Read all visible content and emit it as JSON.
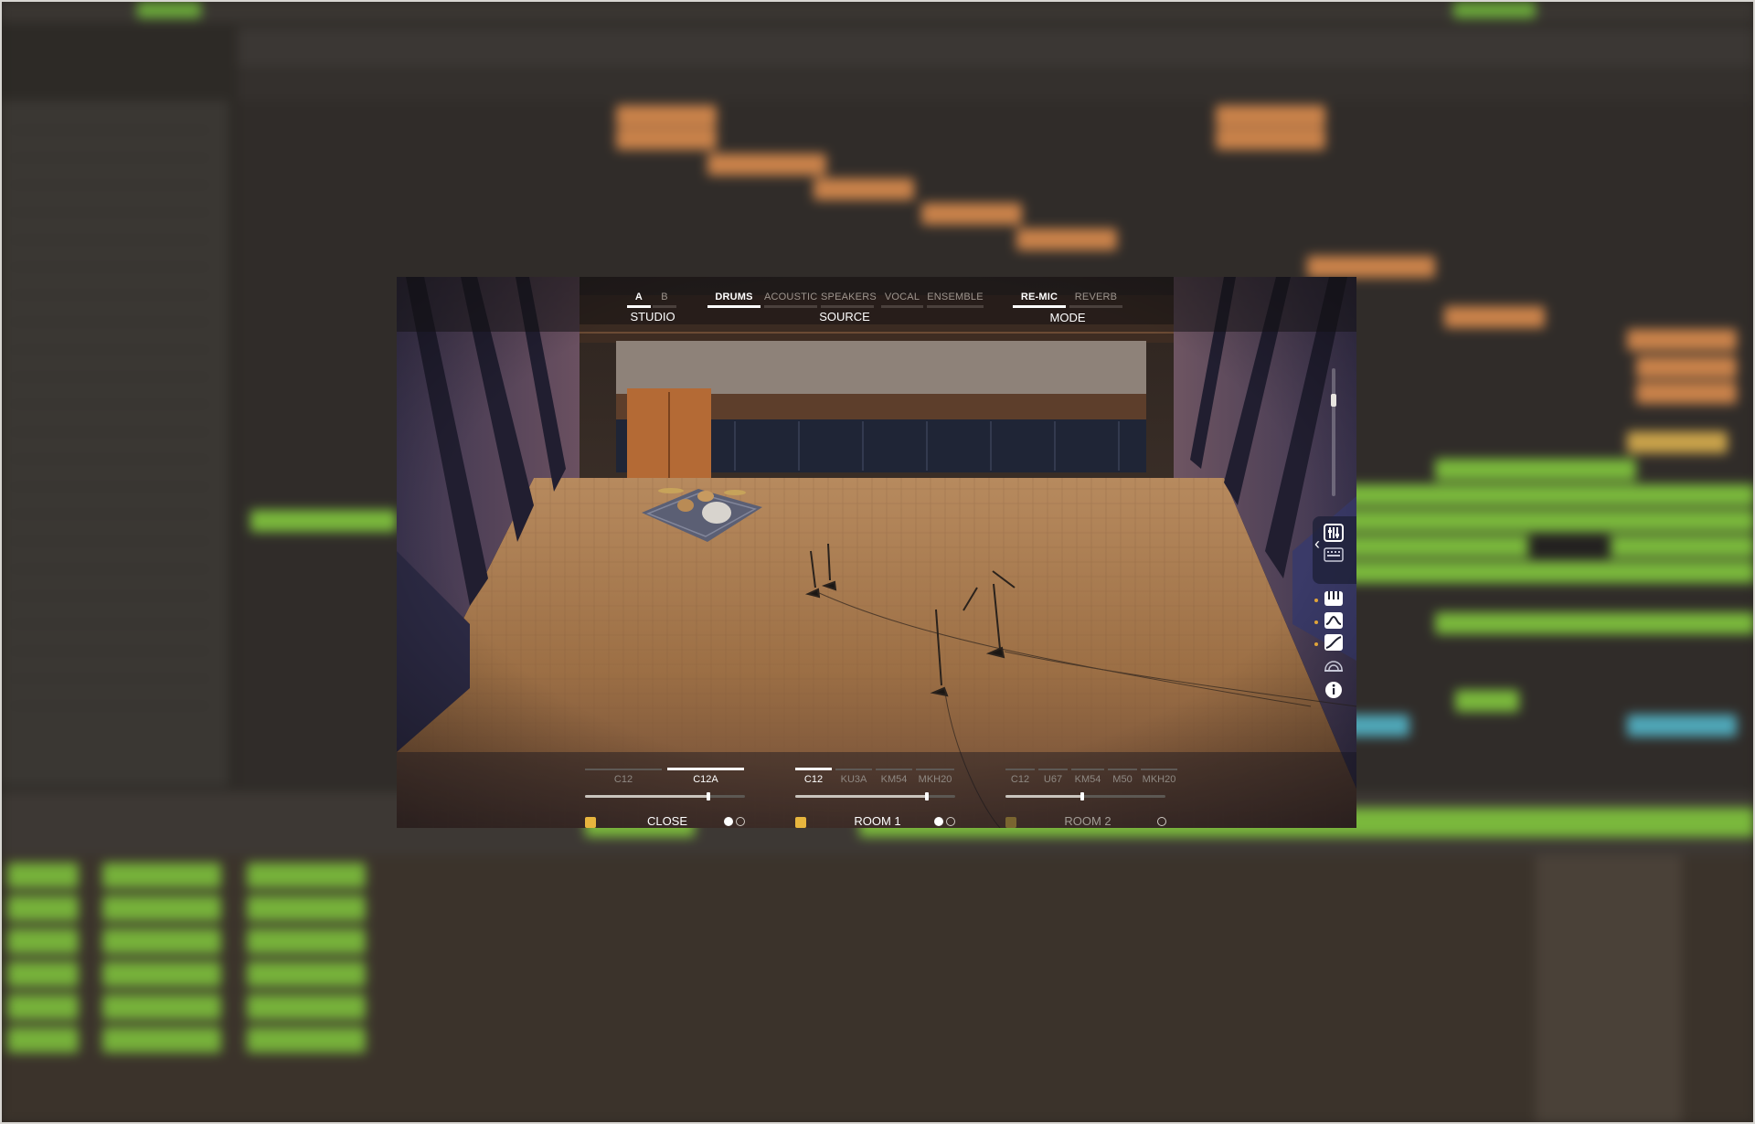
{
  "plugin": {
    "studio": {
      "label": "STUDIO",
      "tabs": [
        "A",
        "B"
      ],
      "active": "A"
    },
    "source": {
      "label": "SOURCE",
      "tabs": [
        "DRUMS",
        "ACOUSTIC",
        "SPEAKERS",
        "VOCAL",
        "ENSEMBLE"
      ],
      "active": "DRUMS"
    },
    "mode": {
      "label": "MODE",
      "tabs": [
        "RE-MIC",
        "REVERB"
      ],
      "active": "RE-MIC"
    },
    "channels": [
      {
        "name": "CLOSE",
        "mics": [
          "C12",
          "C12A"
        ],
        "active_mic": "C12A",
        "level": 0.77,
        "enabled": true
      },
      {
        "name": "ROOM 1",
        "mics": [
          "C12",
          "KU3A",
          "KM54",
          "MKH20"
        ],
        "active_mic": "C12",
        "level": 0.82,
        "enabled": true
      },
      {
        "name": "ROOM 2",
        "mics": [
          "C12",
          "U67",
          "KM54",
          "M50",
          "MKH20"
        ],
        "active_mic": "",
        "level": 0.48,
        "enabled": false
      }
    ],
    "side_icons": [
      "mixer-icon",
      "keyboard-icon",
      "piano-icon",
      "eq-icon",
      "curve-icon",
      "stereo-field-icon",
      "info-icon"
    ],
    "accent_color": "#e7b53e"
  }
}
